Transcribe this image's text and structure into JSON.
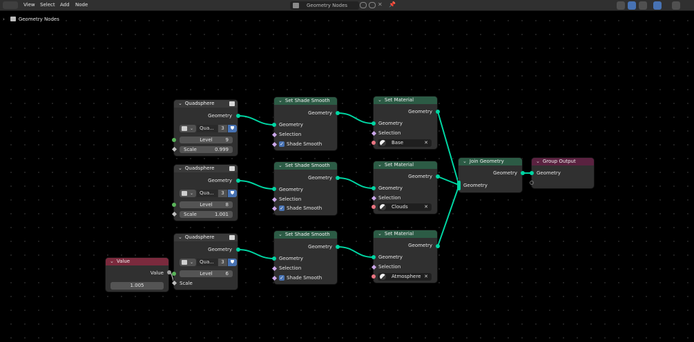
{
  "header": {
    "menus": [
      "View",
      "Select",
      "Add",
      "Node"
    ],
    "tree_name_placeholder": "Geometry Nodes"
  },
  "breadcrumb": {
    "label": "Geometry Nodes"
  },
  "colors": {
    "geometry_socket": "#00d6a3",
    "float_socket": "#a1a1a1",
    "material_socket": "#eb7582",
    "header_geometry": "#3a3a3a",
    "header_operator": "#2c5b45",
    "header_input": "#7b2a3d",
    "header_output": "#5a2240",
    "link": "#00d6a3"
  },
  "quadspheres": [
    {
      "title": "Quadsphere",
      "output": "Geometry",
      "group_name": "Qua...",
      "users": "3",
      "level_label": "Level",
      "level": "9",
      "scale_label": "Scale",
      "scale": "0.999"
    },
    {
      "title": "Quadsphere",
      "output": "Geometry",
      "group_name": "Qua...",
      "users": "3",
      "level_label": "Level",
      "level": "8",
      "scale_label": "Scale",
      "scale": "1.001"
    },
    {
      "title": "Quadsphere",
      "output": "Geometry",
      "group_name": "Qua...",
      "users": "3",
      "level_label": "Level",
      "level": "6",
      "scale_label": "Scale",
      "scale": ""
    }
  ],
  "shade_smooth": [
    {
      "title": "Set Shade Smooth",
      "output": "Geometry",
      "in_geometry": "Geometry",
      "selection": "Selection",
      "shade_smooth": "Shade Smooth"
    },
    {
      "title": "Set Shade Smooth",
      "output": "Geometry",
      "in_geometry": "Geometry",
      "selection": "Selection",
      "shade_smooth": "Shade Smooth"
    },
    {
      "title": "Set Shade Smooth",
      "output": "Geometry",
      "in_geometry": "Geometry",
      "selection": "Selection",
      "shade_smooth": "Shade Smooth"
    }
  ],
  "set_material": [
    {
      "title": "Set Material",
      "output": "Geometry",
      "in_geometry": "Geometry",
      "selection": "Selection",
      "material": "Base"
    },
    {
      "title": "Set Material",
      "output": "Geometry",
      "in_geometry": "Geometry",
      "selection": "Selection",
      "material": "Clouds"
    },
    {
      "title": "Set Material",
      "output": "Geometry",
      "in_geometry": "Geometry",
      "selection": "Selection",
      "material": "Atmosphere"
    }
  ],
  "join": {
    "title": "Join Geometry",
    "output": "Geometry",
    "input": "Geometry"
  },
  "group_output": {
    "title": "Group Output",
    "input": "Geometry"
  },
  "value_node": {
    "title": "Value",
    "output": "Value",
    "value": "1.005"
  }
}
